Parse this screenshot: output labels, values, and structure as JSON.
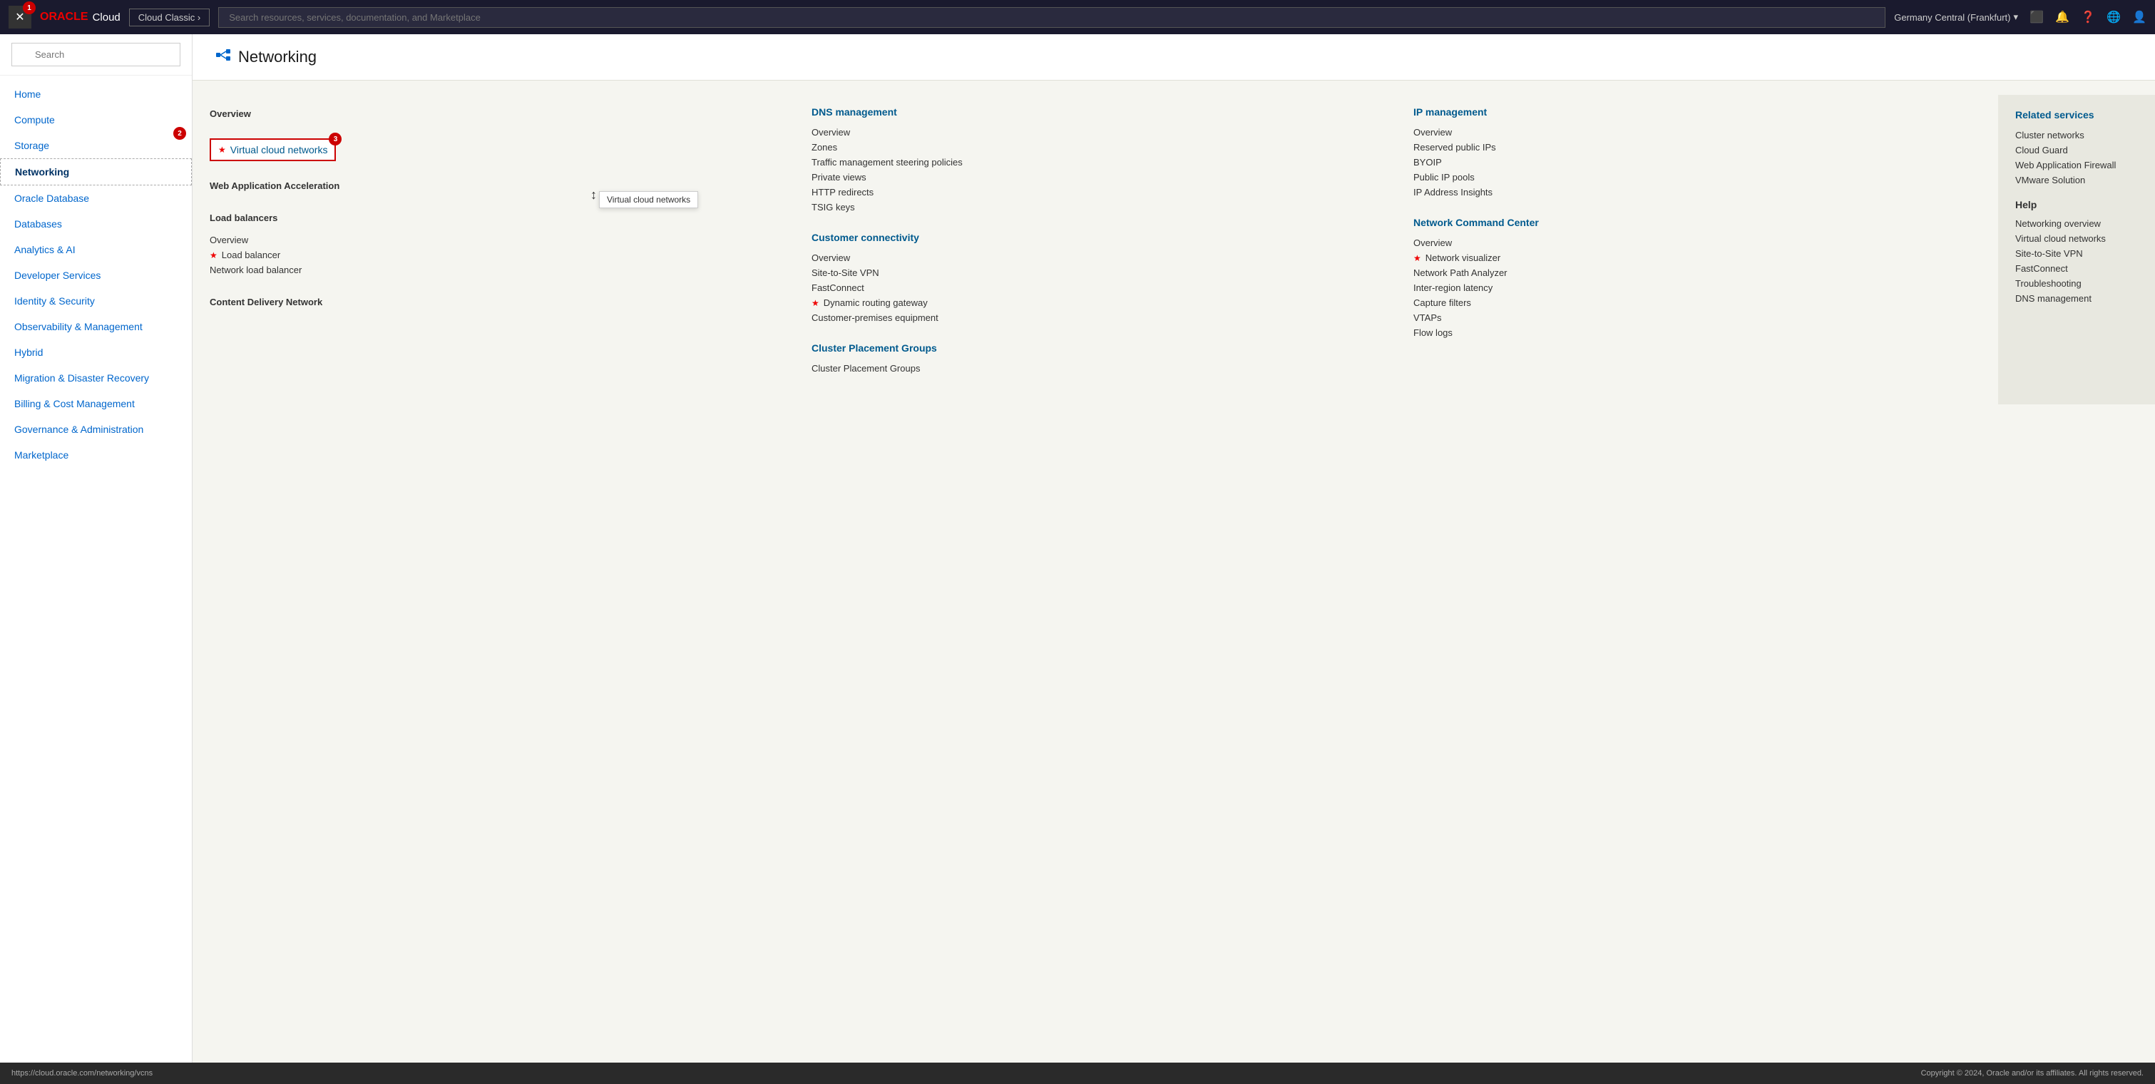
{
  "topbar": {
    "close_label": "✕",
    "badge1": "1",
    "oracle_text": "ORACLE",
    "cloud_text": "Cloud",
    "cloud_classic_label": "Cloud Classic ›",
    "search_placeholder": "Search resources, services, documentation, and Marketplace",
    "region_label": "Germany Central (Frankfurt)",
    "icons": [
      "monitor-icon",
      "bell-icon",
      "question-icon",
      "globe-icon",
      "user-icon"
    ]
  },
  "sidebar": {
    "search_placeholder": "Search",
    "badge2": "2",
    "items": [
      {
        "label": "Home",
        "id": "home"
      },
      {
        "label": "Compute",
        "id": "compute"
      },
      {
        "label": "Storage",
        "id": "storage"
      },
      {
        "label": "Networking",
        "id": "networking",
        "active": true
      },
      {
        "label": "Oracle Database",
        "id": "oracle-database"
      },
      {
        "label": "Databases",
        "id": "databases"
      },
      {
        "label": "Analytics & AI",
        "id": "analytics-ai"
      },
      {
        "label": "Developer Services",
        "id": "developer-services"
      },
      {
        "label": "Identity & Security",
        "id": "identity-security"
      },
      {
        "label": "Observability & Management",
        "id": "observability"
      },
      {
        "label": "Hybrid",
        "id": "hybrid"
      },
      {
        "label": "Migration & Disaster Recovery",
        "id": "migration"
      },
      {
        "label": "Billing & Cost Management",
        "id": "billing"
      },
      {
        "label": "Governance & Administration",
        "id": "governance"
      },
      {
        "label": "Marketplace",
        "id": "marketplace"
      }
    ]
  },
  "page": {
    "title": "Networking",
    "icon": "🔗"
  },
  "col1": {
    "overview_label": "Overview",
    "vcn_label": "Virtual cloud networks",
    "vcn_badge": "3",
    "web_app_accel_label": "Web Application Acceleration",
    "load_balancers_label": "Load balancers",
    "lb_overview": "Overview",
    "lb_loadbalancer": "Load balancer",
    "lb_network": "Network load balancer",
    "cdn_label": "Content Delivery Network"
  },
  "col2": {
    "dns_title": "DNS management",
    "dns_links": [
      "Overview",
      "Zones",
      "Traffic management steering policies",
      "Private views",
      "HTTP redirects",
      "TSIG keys"
    ],
    "customer_title": "Customer connectivity",
    "customer_links": [
      "Overview",
      "Site-to-Site VPN",
      "FastConnect"
    ],
    "dynamic_routing": "Dynamic routing gateway",
    "customer_premises": "Customer-premises equipment",
    "cluster_title": "Cluster Placement Groups",
    "cluster_links": [
      "Cluster Placement Groups"
    ]
  },
  "col3": {
    "ip_title": "IP management",
    "ip_links": [
      "Overview",
      "Reserved public IPs",
      "BYOIP",
      "Public IP pools",
      "IP Address Insights"
    ],
    "ncc_title": "Network Command Center",
    "ncc_overview": "Overview",
    "ncc_visualizer": "Network visualizer",
    "ncc_links": [
      "Network Path Analyzer",
      "Inter-region latency",
      "Capture filters",
      "VTAPs",
      "Flow logs"
    ]
  },
  "col4": {
    "related_title": "Related services",
    "related_links": [
      "Cluster networks",
      "Cloud Guard",
      "Web Application Firewall",
      "VMware Solution"
    ],
    "help_title": "Help",
    "help_links": [
      "Networking overview",
      "Virtual cloud networks",
      "Site-to-Site VPN",
      "FastConnect",
      "Troubleshooting",
      "DNS management"
    ]
  },
  "tooltip": {
    "text": "Virtual cloud networks"
  },
  "footer": {
    "left": "https://cloud.oracle.com/networking/vcns",
    "right": "Copyright © 2024, Oracle and/or its affiliates. All rights reserved."
  }
}
